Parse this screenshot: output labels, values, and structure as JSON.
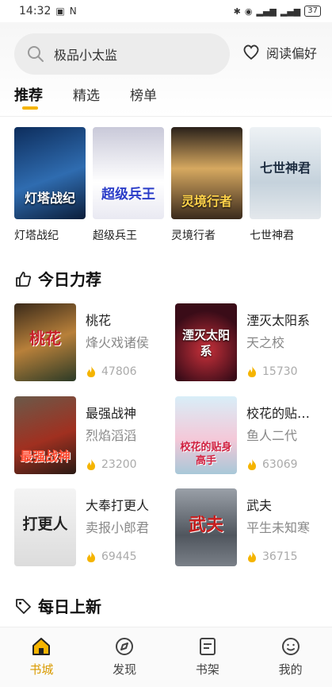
{
  "status": {
    "time": "14:32",
    "battery": "37"
  },
  "search": {
    "text": "极品小太监"
  },
  "preference": {
    "label": "阅读偏好"
  },
  "tabs": [
    {
      "label": "推荐",
      "active": true
    },
    {
      "label": "精选",
      "active": false
    },
    {
      "label": "榜单",
      "active": false
    }
  ],
  "top_books": [
    {
      "title": "灯塔战纪",
      "cover_text": "灯塔战纪",
      "cover_color": "#1d3a6e"
    },
    {
      "title": "超级兵王",
      "cover_text": "超级兵王",
      "cover_color": "#d8d8e8"
    },
    {
      "title": "灵境行者",
      "cover_text": "灵境行者",
      "cover_color": "#3a2e24"
    },
    {
      "title": "七世神君",
      "cover_text": "七世神君",
      "cover_color": "#dfe6ec"
    }
  ],
  "today_section": {
    "title": "今日力荐"
  },
  "today_books": [
    {
      "title": "桃花",
      "author": "烽火戏诸侯",
      "hot": "47806",
      "cover_text": "桃花",
      "cover_color": "#6b4a2e"
    },
    {
      "title": "湮灭太阳系",
      "author": "天之校",
      "hot": "15730",
      "cover_text": "湮灭太阳系",
      "cover_color": "#8a1d2a"
    },
    {
      "title": "最强战神",
      "author": "烈焰滔滔",
      "hot": "23200",
      "cover_text": "最强战神",
      "cover_color": "#5a4436"
    },
    {
      "title": "校花的贴…",
      "author": "鱼人二代",
      "hot": "63069",
      "cover_text": "校花的贴身高手",
      "cover_color": "#a8c8d8"
    },
    {
      "title": "大奉打更人",
      "author": "卖报小郎君",
      "hot": "69445",
      "cover_text": "打更人",
      "cover_color": "#e8e8e8"
    },
    {
      "title": "武夫",
      "author": "平生未知寒",
      "hot": "36715",
      "cover_text": "武夫",
      "cover_color": "#7a8088"
    }
  ],
  "new_section": {
    "title": "每日上新"
  },
  "nav": [
    {
      "label": "书城",
      "icon": "home-icon",
      "active": true
    },
    {
      "label": "发现",
      "icon": "discover-icon",
      "active": false
    },
    {
      "label": "书架",
      "icon": "bookshelf-icon",
      "active": false
    },
    {
      "label": "我的",
      "icon": "profile-icon",
      "active": false
    }
  ],
  "colors": {
    "accent": "#f5b400",
    "hot_icon": "#f5b400"
  }
}
